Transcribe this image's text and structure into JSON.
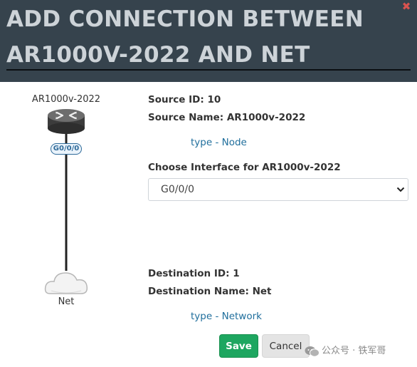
{
  "dialog": {
    "title_line1": "ADD CONNECTION BETWEEN",
    "title_line2": "AR1000V-2022 AND NET",
    "close_glyph": "✖"
  },
  "topology": {
    "source_node_label": "AR1000v-2022",
    "source_icon": "router-icon",
    "interface_badge": "G0/0/0",
    "destination_node_label": "Net",
    "destination_icon": "cloud-icon"
  },
  "source": {
    "id_text": "Source ID: 10",
    "name_text": "Source Name: AR1000v-2022",
    "type_text": "type - Node"
  },
  "interface": {
    "label": "Choose Interface for AR1000v-2022",
    "selected_value": "G0/0/0"
  },
  "destination": {
    "id_text": "Destination ID: 1",
    "name_text": "Destination Name: Net",
    "type_text": "type - Network"
  },
  "buttons": {
    "save_label": "Save",
    "cancel_label": "Cancel"
  },
  "watermark": {
    "text": "公众号 · 铁军哥"
  },
  "colors": {
    "header_bg": "#36434d",
    "title_text": "#cdd3d8",
    "save_bg": "#1ea660",
    "link_blue": "#1f6e9c",
    "close_red": "#d9534f"
  }
}
